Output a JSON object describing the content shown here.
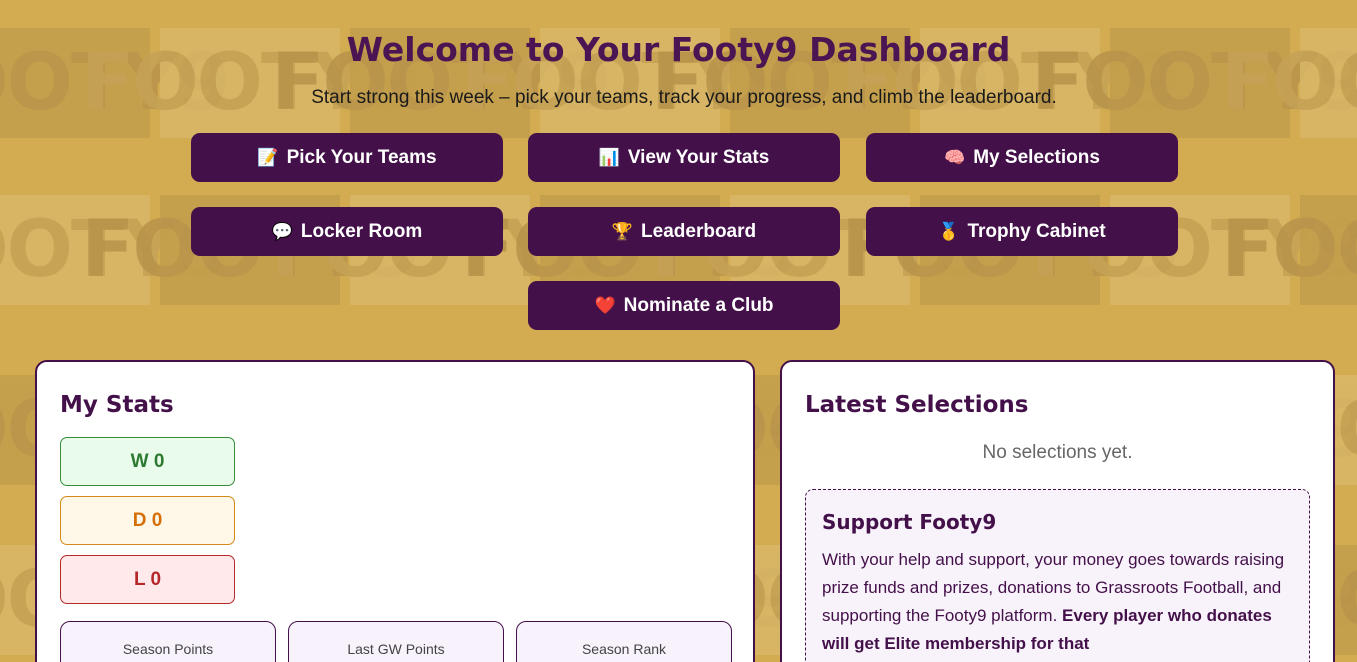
{
  "header": {
    "title": "Welcome to Your Footy9 Dashboard",
    "subtitle": "Start strong this week – pick your teams, track your progress, and climb the leaderboard."
  },
  "background": {
    "logo_text": "FOOTY9"
  },
  "nav": {
    "pick_teams": {
      "emoji": "📝",
      "label": "Pick Your Teams"
    },
    "view_stats": {
      "emoji": "📊",
      "label": "View Your Stats"
    },
    "my_selections": {
      "emoji": "🧠",
      "label": "My Selections"
    },
    "locker_room": {
      "emoji": "💬",
      "label": "Locker Room"
    },
    "leaderboard": {
      "emoji": "🏆",
      "label": "Leaderboard"
    },
    "trophy_cabinet": {
      "emoji": "🥇",
      "label": "Trophy Cabinet"
    },
    "nominate_club": {
      "emoji": "❤️",
      "label": "Nominate a Club"
    }
  },
  "my_stats": {
    "title": "My Stats",
    "win": "W 0",
    "draw": "D 0",
    "loss": "L 0",
    "boxes": [
      "Season Points",
      "Last GW Points",
      "Season Rank"
    ]
  },
  "latest_selections": {
    "title": "Latest Selections",
    "empty": "No selections yet.",
    "support": {
      "title": "Support Footy9",
      "text": "With your help and support, your money goes towards raising prize funds and prizes, donations to Grassroots Football, and supporting the Footy9 platform.",
      "bold": "Every player who donates will get Elite membership for that"
    }
  },
  "colors": {
    "primary": "#43104a",
    "background": "#d3ac52",
    "win": "#2f7a33",
    "draw": "#d66f08",
    "loss": "#b5282a"
  }
}
